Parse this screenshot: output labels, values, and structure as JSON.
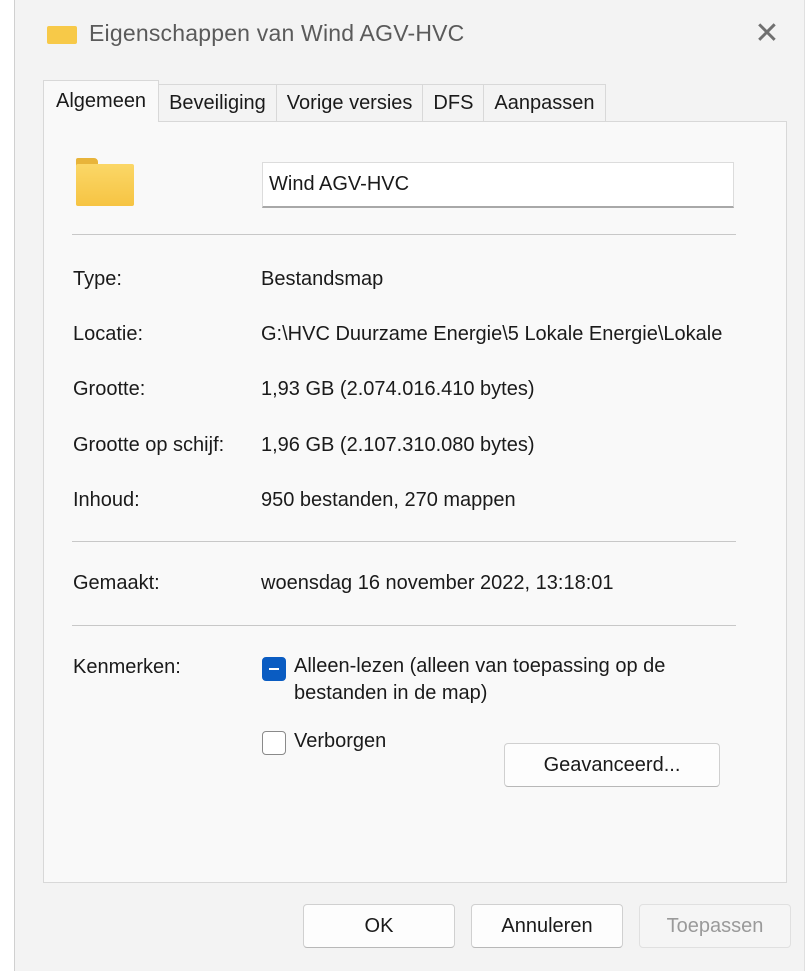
{
  "window": {
    "title": "Eigenschappen van Wind AGV-HVC",
    "close_glyph": "✕"
  },
  "tabs": [
    {
      "label": "Algemeen",
      "active": true
    },
    {
      "label": "Beveiliging",
      "active": false
    },
    {
      "label": "Vorige versies",
      "active": false
    },
    {
      "label": "DFS",
      "active": false
    },
    {
      "label": "Aanpassen",
      "active": false
    }
  ],
  "general": {
    "name_value": "Wind AGV-HVC",
    "type_label": "Type:",
    "type_value": "Bestandsmap",
    "location_label": "Locatie:",
    "location_value": "G:\\HVC Duurzame Energie\\5 Lokale Energie\\Lokale",
    "size_label": "Grootte:",
    "size_value": "1,93 GB (2.074.016.410 bytes)",
    "size_on_disk_label": "Grootte op schijf:",
    "size_on_disk_value": "1,96 GB (2.107.310.080 bytes)",
    "contents_label": "Inhoud:",
    "contents_value": "950 bestanden, 270 mappen",
    "created_label": "Gemaakt:",
    "created_value": "woensdag 16 november 2022, 13:18:01",
    "attributes_label": "Kenmerken:",
    "readonly_label": "Alleen-lezen (alleen van toepassing op de bestanden in de map)",
    "readonly_state": "indeterminate",
    "hidden_label": "Verborgen",
    "hidden_state": "unchecked",
    "advanced_button": "Geavanceerd..."
  },
  "footer": {
    "ok_label": "OK",
    "cancel_label": "Annuleren",
    "apply_label": "Toepassen"
  },
  "colors": {
    "accent": "#0a5cc2",
    "folder": "#f7c948"
  }
}
